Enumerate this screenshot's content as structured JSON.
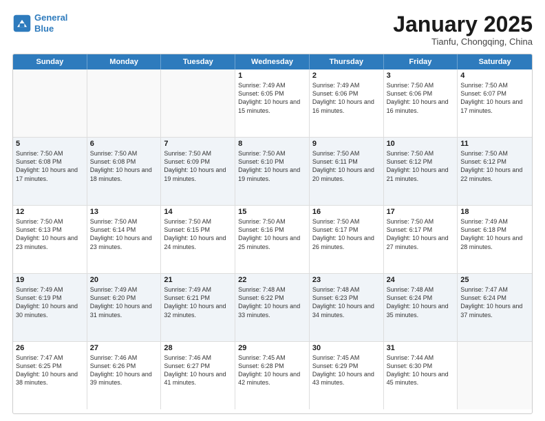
{
  "header": {
    "logo_line1": "General",
    "logo_line2": "Blue",
    "month_title": "January 2025",
    "location": "Tianfu, Chongqing, China"
  },
  "days_of_week": [
    "Sunday",
    "Monday",
    "Tuesday",
    "Wednesday",
    "Thursday",
    "Friday",
    "Saturday"
  ],
  "weeks": [
    [
      {
        "day": "",
        "empty": true
      },
      {
        "day": "",
        "empty": true
      },
      {
        "day": "",
        "empty": true
      },
      {
        "day": "1",
        "sunrise": "7:49 AM",
        "sunset": "6:05 PM",
        "daylight": "10 hours and 15 minutes."
      },
      {
        "day": "2",
        "sunrise": "7:49 AM",
        "sunset": "6:06 PM",
        "daylight": "10 hours and 16 minutes."
      },
      {
        "day": "3",
        "sunrise": "7:50 AM",
        "sunset": "6:06 PM",
        "daylight": "10 hours and 16 minutes."
      },
      {
        "day": "4",
        "sunrise": "7:50 AM",
        "sunset": "6:07 PM",
        "daylight": "10 hours and 17 minutes."
      }
    ],
    [
      {
        "day": "5",
        "sunrise": "7:50 AM",
        "sunset": "6:08 PM",
        "daylight": "10 hours and 17 minutes."
      },
      {
        "day": "6",
        "sunrise": "7:50 AM",
        "sunset": "6:08 PM",
        "daylight": "10 hours and 18 minutes."
      },
      {
        "day": "7",
        "sunrise": "7:50 AM",
        "sunset": "6:09 PM",
        "daylight": "10 hours and 19 minutes."
      },
      {
        "day": "8",
        "sunrise": "7:50 AM",
        "sunset": "6:10 PM",
        "daylight": "10 hours and 19 minutes."
      },
      {
        "day": "9",
        "sunrise": "7:50 AM",
        "sunset": "6:11 PM",
        "daylight": "10 hours and 20 minutes."
      },
      {
        "day": "10",
        "sunrise": "7:50 AM",
        "sunset": "6:12 PM",
        "daylight": "10 hours and 21 minutes."
      },
      {
        "day": "11",
        "sunrise": "7:50 AM",
        "sunset": "6:12 PM",
        "daylight": "10 hours and 22 minutes."
      }
    ],
    [
      {
        "day": "12",
        "sunrise": "7:50 AM",
        "sunset": "6:13 PM",
        "daylight": "10 hours and 23 minutes."
      },
      {
        "day": "13",
        "sunrise": "7:50 AM",
        "sunset": "6:14 PM",
        "daylight": "10 hours and 23 minutes."
      },
      {
        "day": "14",
        "sunrise": "7:50 AM",
        "sunset": "6:15 PM",
        "daylight": "10 hours and 24 minutes."
      },
      {
        "day": "15",
        "sunrise": "7:50 AM",
        "sunset": "6:16 PM",
        "daylight": "10 hours and 25 minutes."
      },
      {
        "day": "16",
        "sunrise": "7:50 AM",
        "sunset": "6:17 PM",
        "daylight": "10 hours and 26 minutes."
      },
      {
        "day": "17",
        "sunrise": "7:50 AM",
        "sunset": "6:17 PM",
        "daylight": "10 hours and 27 minutes."
      },
      {
        "day": "18",
        "sunrise": "7:49 AM",
        "sunset": "6:18 PM",
        "daylight": "10 hours and 28 minutes."
      }
    ],
    [
      {
        "day": "19",
        "sunrise": "7:49 AM",
        "sunset": "6:19 PM",
        "daylight": "10 hours and 30 minutes."
      },
      {
        "day": "20",
        "sunrise": "7:49 AM",
        "sunset": "6:20 PM",
        "daylight": "10 hours and 31 minutes."
      },
      {
        "day": "21",
        "sunrise": "7:49 AM",
        "sunset": "6:21 PM",
        "daylight": "10 hours and 32 minutes."
      },
      {
        "day": "22",
        "sunrise": "7:48 AM",
        "sunset": "6:22 PM",
        "daylight": "10 hours and 33 minutes."
      },
      {
        "day": "23",
        "sunrise": "7:48 AM",
        "sunset": "6:23 PM",
        "daylight": "10 hours and 34 minutes."
      },
      {
        "day": "24",
        "sunrise": "7:48 AM",
        "sunset": "6:24 PM",
        "daylight": "10 hours and 35 minutes."
      },
      {
        "day": "25",
        "sunrise": "7:47 AM",
        "sunset": "6:24 PM",
        "daylight": "10 hours and 37 minutes."
      }
    ],
    [
      {
        "day": "26",
        "sunrise": "7:47 AM",
        "sunset": "6:25 PM",
        "daylight": "10 hours and 38 minutes."
      },
      {
        "day": "27",
        "sunrise": "7:46 AM",
        "sunset": "6:26 PM",
        "daylight": "10 hours and 39 minutes."
      },
      {
        "day": "28",
        "sunrise": "7:46 AM",
        "sunset": "6:27 PM",
        "daylight": "10 hours and 41 minutes."
      },
      {
        "day": "29",
        "sunrise": "7:45 AM",
        "sunset": "6:28 PM",
        "daylight": "10 hours and 42 minutes."
      },
      {
        "day": "30",
        "sunrise": "7:45 AM",
        "sunset": "6:29 PM",
        "daylight": "10 hours and 43 minutes."
      },
      {
        "day": "31",
        "sunrise": "7:44 AM",
        "sunset": "6:30 PM",
        "daylight": "10 hours and 45 minutes."
      },
      {
        "day": "",
        "empty": true
      }
    ]
  ]
}
